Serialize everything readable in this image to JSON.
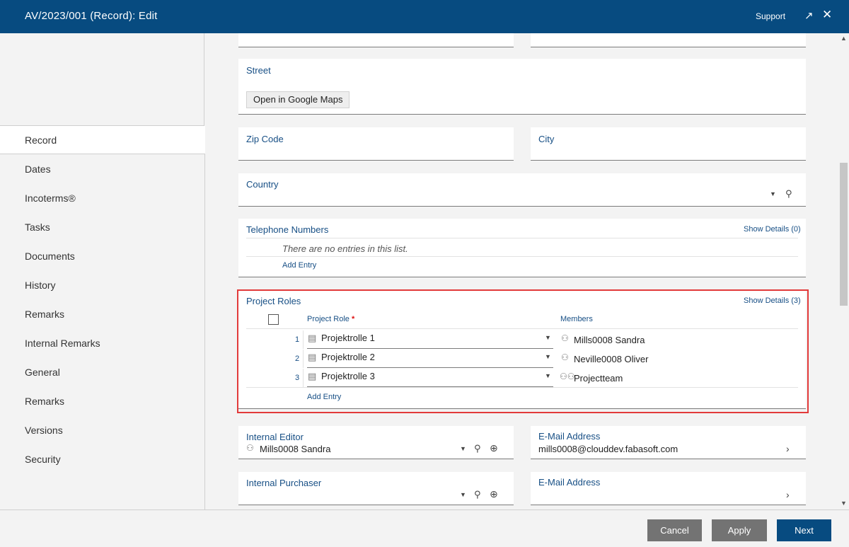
{
  "header": {
    "title": "AV/2023/001 (Record): Edit",
    "support": "Support",
    "expand_icon": "↗",
    "close_icon": "✕"
  },
  "sidebar": {
    "items": [
      "Record",
      "Dates",
      "Incoterms®",
      "Tasks",
      "Documents",
      "History",
      "Remarks",
      "Internal Remarks",
      "General",
      "Remarks",
      "Versions",
      "Security"
    ]
  },
  "form": {
    "street": {
      "label": "Street",
      "maps_button": "Open in Google Maps"
    },
    "zip": {
      "label": "Zip Code"
    },
    "city": {
      "label": "City"
    },
    "country": {
      "label": "Country"
    },
    "telephone": {
      "label": "Telephone Numbers",
      "details": "Show Details (0)",
      "empty": "There are no entries in this list.",
      "add": "Add Entry"
    },
    "project_roles": {
      "label": "Project Roles",
      "details": "Show Details (3)",
      "col_role": "Project Role",
      "required_mark": "*",
      "col_members": "Members",
      "rows": [
        {
          "num": "1",
          "role": "Projektrolle 1",
          "member": "Mills0008 Sandra",
          "member_icon": "person-icon"
        },
        {
          "num": "2",
          "role": "Projektrolle 2",
          "member": "Neville0008 Oliver",
          "member_icon": "person-icon"
        },
        {
          "num": "3",
          "role": "Projektrolle 3",
          "member": "Projectteam",
          "member_icon": "group-icon"
        }
      ],
      "add": "Add Entry"
    },
    "internal_editor": {
      "label": "Internal Editor",
      "value": "Mills0008 Sandra"
    },
    "editor_email": {
      "label": "E-Mail Address",
      "value": "mills0008@clouddev.fabasoft.com"
    },
    "internal_purchaser": {
      "label": "Internal Purchaser"
    },
    "purchaser_email": {
      "label": "E-Mail Address"
    }
  },
  "footer": {
    "cancel": "Cancel",
    "apply": "Apply",
    "next": "Next"
  },
  "colors": {
    "header": "#074b80",
    "label": "#174f85",
    "highlight": "#e23a3a",
    "button_gray": "#737373",
    "button_primary": "#074b80"
  }
}
